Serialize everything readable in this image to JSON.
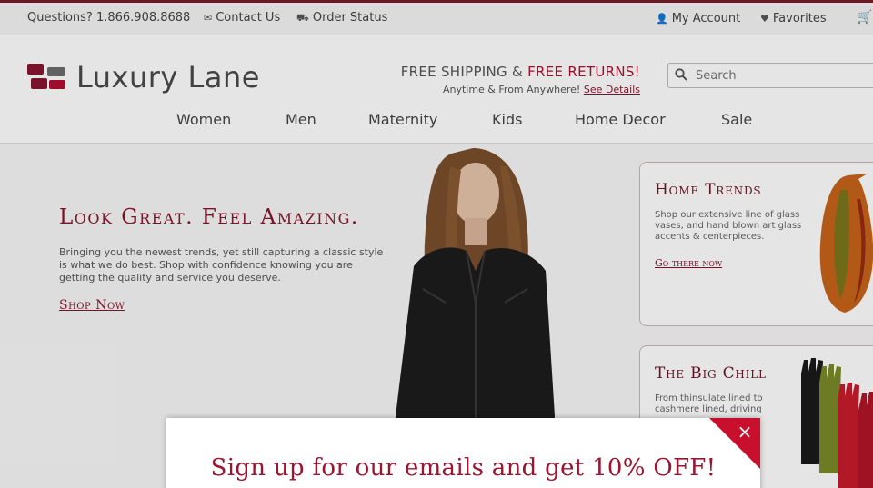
{
  "topbar": {
    "phone": "Questions? 1.866.908.8688",
    "contact": "Contact Us",
    "order_status": "Order Status",
    "account": "My Account",
    "favorites": "Favorites"
  },
  "header": {
    "logo_text": "Luxury Lane",
    "promo_prefix": "FREE SHIPPING & ",
    "promo_highlight": "FREE RETURNS!",
    "promo_sub": "Anytime & From Anywhere!",
    "promo_link": "See Details",
    "search_placeholder": "Search"
  },
  "nav": [
    "Women",
    "Men",
    "Maternity",
    "Kids",
    "Home Decor",
    "Sale"
  ],
  "hero": {
    "headline": "Look Great.  Feel Amazing.",
    "body": "Bringing you the newest trends, yet still capturing a classic style is what we do best.  Shop with confidence knowing you are getting the quality and service you deserve.",
    "cta": "Shop Now"
  },
  "cards": [
    {
      "title": "Home Trends",
      "body": "Shop our extensive line of glass vases, and hand blown art glass accents & centerpieces.",
      "cta": "Go there now"
    },
    {
      "title": "The Big Chill",
      "body": "From thinsulate lined to cashmere lined, driving"
    }
  ],
  "modal": {
    "headline": "Sign up for our emails and get 10% OFF!",
    "close_symbol": "×"
  },
  "colors": {
    "brand": "#8a1530",
    "accent_red": "#b01030",
    "modal_corner": "#c8102e"
  }
}
